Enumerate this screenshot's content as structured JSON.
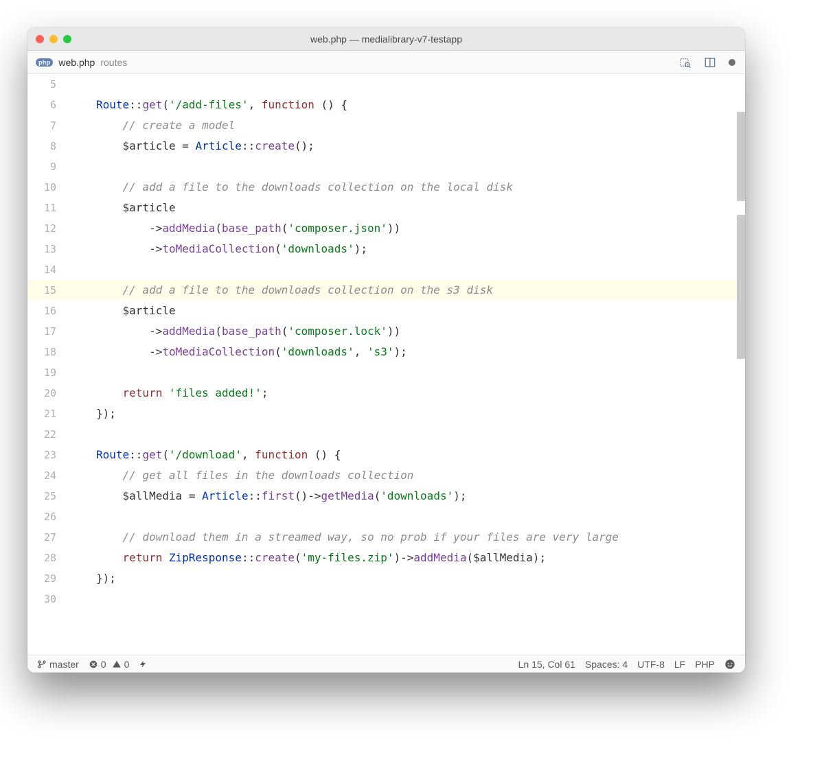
{
  "window": {
    "title": "web.php — medialibrary-v7-testapp"
  },
  "tab": {
    "badge": "php",
    "filename": "web.php",
    "folder": "routes"
  },
  "gutterStart": 5,
  "highlightLine": 15,
  "code": [
    [],
    [
      {
        "c": "tok-class",
        "t": "Route"
      },
      {
        "c": "tok-op",
        "t": "::"
      },
      {
        "c": "tok-func",
        "t": "get"
      },
      {
        "c": "tok-braces",
        "t": "("
      },
      {
        "c": "tok-str",
        "t": "'/add-files'"
      },
      {
        "c": "tok-op",
        "t": ", "
      },
      {
        "c": "tok-kw",
        "t": "function"
      },
      {
        "c": "tok-op",
        "t": " () {"
      }
    ],
    [
      {
        "c": "tok-op",
        "t": "    "
      },
      {
        "c": "tok-cmt",
        "t": "// create a model"
      }
    ],
    [
      {
        "c": "tok-op",
        "t": "    "
      },
      {
        "c": "tok-var",
        "t": "$article"
      },
      {
        "c": "tok-op",
        "t": " = "
      },
      {
        "c": "tok-class",
        "t": "Article"
      },
      {
        "c": "tok-op",
        "t": "::"
      },
      {
        "c": "tok-func",
        "t": "create"
      },
      {
        "c": "tok-braces",
        "t": "();"
      }
    ],
    [],
    [
      {
        "c": "tok-op",
        "t": "    "
      },
      {
        "c": "tok-cmt",
        "t": "// add a file to the downloads collection on the local disk"
      }
    ],
    [
      {
        "c": "tok-op",
        "t": "    "
      },
      {
        "c": "tok-var",
        "t": "$article"
      }
    ],
    [
      {
        "c": "tok-op",
        "t": "        ->"
      },
      {
        "c": "tok-func",
        "t": "addMedia"
      },
      {
        "c": "tok-braces",
        "t": "("
      },
      {
        "c": "tok-func",
        "t": "base_path"
      },
      {
        "c": "tok-braces",
        "t": "("
      },
      {
        "c": "tok-str",
        "t": "'composer.json'"
      },
      {
        "c": "tok-braces",
        "t": "))"
      }
    ],
    [
      {
        "c": "tok-op",
        "t": "        ->"
      },
      {
        "c": "tok-func",
        "t": "toMediaCollection"
      },
      {
        "c": "tok-braces",
        "t": "("
      },
      {
        "c": "tok-str",
        "t": "'downloads'"
      },
      {
        "c": "tok-braces",
        "t": ");"
      }
    ],
    [],
    [
      {
        "c": "tok-op",
        "t": "    "
      },
      {
        "c": "tok-cmt",
        "t": "// add a file to the downloads collection on the s3 disk"
      }
    ],
    [
      {
        "c": "tok-op",
        "t": "    "
      },
      {
        "c": "tok-var",
        "t": "$article"
      }
    ],
    [
      {
        "c": "tok-op",
        "t": "        ->"
      },
      {
        "c": "tok-func",
        "t": "addMedia"
      },
      {
        "c": "tok-braces",
        "t": "("
      },
      {
        "c": "tok-func",
        "t": "base_path"
      },
      {
        "c": "tok-braces",
        "t": "("
      },
      {
        "c": "tok-str",
        "t": "'composer.lock'"
      },
      {
        "c": "tok-braces",
        "t": "))"
      }
    ],
    [
      {
        "c": "tok-op",
        "t": "        ->"
      },
      {
        "c": "tok-func",
        "t": "toMediaCollection"
      },
      {
        "c": "tok-braces",
        "t": "("
      },
      {
        "c": "tok-str",
        "t": "'downloads'"
      },
      {
        "c": "tok-op",
        "t": ", "
      },
      {
        "c": "tok-str",
        "t": "'s3'"
      },
      {
        "c": "tok-braces",
        "t": ");"
      }
    ],
    [],
    [
      {
        "c": "tok-op",
        "t": "    "
      },
      {
        "c": "tok-kw",
        "t": "return"
      },
      {
        "c": "tok-op",
        "t": " "
      },
      {
        "c": "tok-str",
        "t": "'files added!'"
      },
      {
        "c": "tok-braces",
        "t": ";"
      }
    ],
    [
      {
        "c": "tok-braces",
        "t": "});"
      }
    ],
    [],
    [
      {
        "c": "tok-class",
        "t": "Route"
      },
      {
        "c": "tok-op",
        "t": "::"
      },
      {
        "c": "tok-func",
        "t": "get"
      },
      {
        "c": "tok-braces",
        "t": "("
      },
      {
        "c": "tok-str",
        "t": "'/download'"
      },
      {
        "c": "tok-op",
        "t": ", "
      },
      {
        "c": "tok-kw",
        "t": "function"
      },
      {
        "c": "tok-op",
        "t": " () {"
      }
    ],
    [
      {
        "c": "tok-op",
        "t": "    "
      },
      {
        "c": "tok-cmt",
        "t": "// get all files in the downloads collection"
      }
    ],
    [
      {
        "c": "tok-op",
        "t": "    "
      },
      {
        "c": "tok-var",
        "t": "$allMedia"
      },
      {
        "c": "tok-op",
        "t": " = "
      },
      {
        "c": "tok-class",
        "t": "Article"
      },
      {
        "c": "tok-op",
        "t": "::"
      },
      {
        "c": "tok-func",
        "t": "first"
      },
      {
        "c": "tok-braces",
        "t": "()->"
      },
      {
        "c": "tok-func",
        "t": "getMedia"
      },
      {
        "c": "tok-braces",
        "t": "("
      },
      {
        "c": "tok-str",
        "t": "'downloads'"
      },
      {
        "c": "tok-braces",
        "t": ");"
      }
    ],
    [],
    [
      {
        "c": "tok-op",
        "t": "    "
      },
      {
        "c": "tok-cmt",
        "t": "// download them in a streamed way, so no prob if your files are very large"
      }
    ],
    [
      {
        "c": "tok-op",
        "t": "    "
      },
      {
        "c": "tok-kw",
        "t": "return"
      },
      {
        "c": "tok-op",
        "t": " "
      },
      {
        "c": "tok-class",
        "t": "ZipResponse"
      },
      {
        "c": "tok-op",
        "t": "::"
      },
      {
        "c": "tok-func",
        "t": "create"
      },
      {
        "c": "tok-braces",
        "t": "("
      },
      {
        "c": "tok-str",
        "t": "'my-files.zip'"
      },
      {
        "c": "tok-braces",
        "t": ")->"
      },
      {
        "c": "tok-func",
        "t": "addMedia"
      },
      {
        "c": "tok-braces",
        "t": "("
      },
      {
        "c": "tok-var",
        "t": "$allMedia"
      },
      {
        "c": "tok-braces",
        "t": ");"
      }
    ],
    [
      {
        "c": "tok-braces",
        "t": "});"
      }
    ],
    []
  ],
  "indentGuide": [
    false,
    false,
    true,
    true,
    true,
    true,
    true,
    true,
    true,
    true,
    true,
    true,
    true,
    true,
    true,
    true,
    false,
    false,
    false,
    true,
    true,
    true,
    true,
    true,
    false,
    false
  ],
  "status": {
    "branch": "master",
    "errors": "0",
    "warnings": "0",
    "position": "Ln 15, Col 61",
    "spaces": "Spaces: 4",
    "encoding": "UTF-8",
    "eol": "LF",
    "language": "PHP"
  }
}
